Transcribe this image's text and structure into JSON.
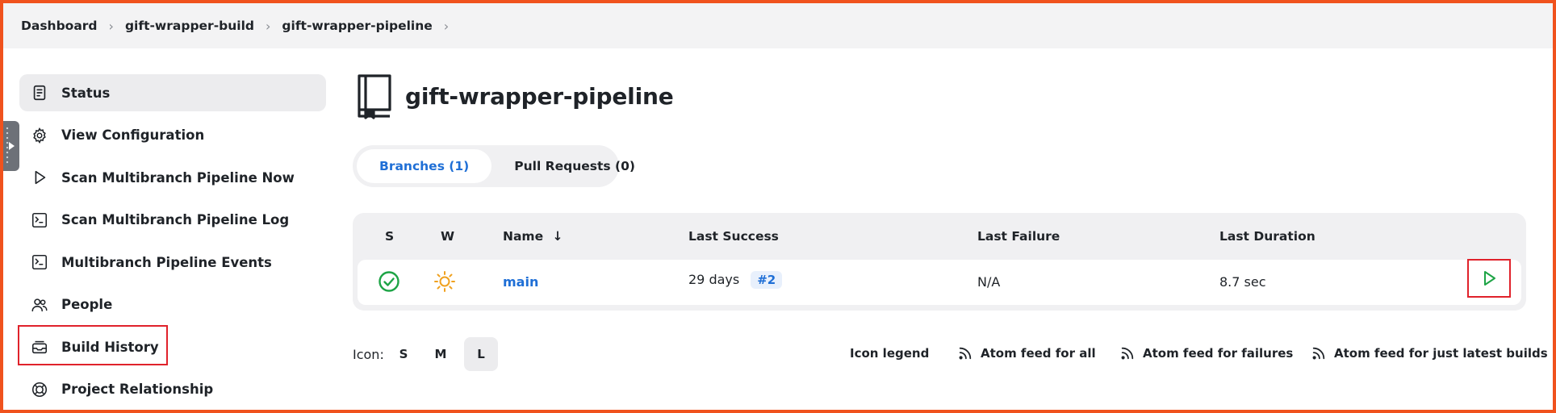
{
  "breadcrumb": [
    {
      "label": "Dashboard"
    },
    {
      "label": "gift-wrapper-build"
    },
    {
      "label": "gift-wrapper-pipeline"
    }
  ],
  "sidebar": {
    "items": [
      {
        "label": "Status",
        "icon": "document-icon"
      },
      {
        "label": "View Configuration",
        "icon": "gear-icon"
      },
      {
        "label": "Scan Multibranch Pipeline Now",
        "icon": "play-icon"
      },
      {
        "label": "Scan Multibranch Pipeline Log",
        "icon": "terminal-icon"
      },
      {
        "label": "Multibranch Pipeline Events",
        "icon": "terminal-icon"
      },
      {
        "label": "People",
        "icon": "people-icon"
      },
      {
        "label": "Build History",
        "icon": "inbox-icon"
      },
      {
        "label": "Project Relationship",
        "icon": "relationship-icon"
      }
    ]
  },
  "page": {
    "title": "gift-wrapper-pipeline"
  },
  "tabs": [
    {
      "label": "Branches (1)",
      "active": true
    },
    {
      "label": "Pull Requests (0)",
      "active": false
    }
  ],
  "table": {
    "headers": {
      "s": "S",
      "w": "W",
      "name": "Name",
      "name_sort": "↓",
      "last_success": "Last Success",
      "last_failure": "Last Failure",
      "last_duration": "Last Duration"
    },
    "rows": [
      {
        "status": "success",
        "weather": "sunny",
        "name": "main",
        "last_success": "29 days",
        "build": "#2",
        "last_failure": "N/A",
        "last_duration": "8.7 sec"
      }
    ]
  },
  "footer": {
    "icon_label": "Icon:",
    "sizes": [
      {
        "label": "S",
        "active": false
      },
      {
        "label": "M",
        "active": false
      },
      {
        "label": "L",
        "active": true
      }
    ],
    "icon_legend": "Icon legend",
    "feed_all": "Atom feed for all",
    "feed_failures": "Atom feed for failures",
    "feed_latest": "Atom feed for just latest builds"
  },
  "colors": {
    "accent": "#1f6fd6",
    "success": "#1ea446",
    "weather": "#f0a11f",
    "highlight": "#e0222b",
    "frame": "#f0521d"
  }
}
